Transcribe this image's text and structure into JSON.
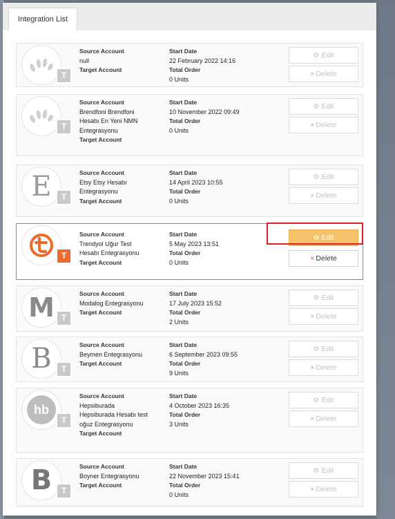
{
  "tab": {
    "label": "Integration List"
  },
  "labels": {
    "source": "Source Account",
    "target": "Target Account",
    "start": "Start Date",
    "total": "Total Order",
    "edit": "Edit",
    "delete": "Delete"
  },
  "cards": [
    {
      "source_lines": [
        "null"
      ],
      "start_date": "22 February 2022 14:16",
      "total": "0 Units",
      "logo": "paw-icon",
      "badge": "T"
    },
    {
      "source_lines": [
        "Brendfoni Brendfoni",
        "Hesabı En Yeni NMN",
        "Entegrasyonu"
      ],
      "start_date": "10 November 2022 09:49",
      "total": "0 Units",
      "logo": "paw-icon",
      "badge": "T"
    },
    {
      "source_lines": [
        "Etsy Etsy Hesabı",
        "Entegrasyonu"
      ],
      "start_date": "14 April 2023 10:55",
      "total": "0 Units",
      "logo": "E",
      "badge": "T"
    },
    {
      "source_lines": [
        "Trendyol Uğur Test",
        "Hesabı Entegrasyonu"
      ],
      "start_date": "5 May 2023 13:51",
      "total": "0 Units",
      "logo": "trendyol-icon",
      "badge": "T",
      "active": true
    },
    {
      "source_lines": [
        "Modalog Entegrasyonu"
      ],
      "start_date": "17 July 2023 15:52",
      "total": "2 Units",
      "logo": "M",
      "badge": "T"
    },
    {
      "source_lines": [
        "Beymen Entegrasyonu"
      ],
      "start_date": "6 September 2023 09:55",
      "total": "9 Units",
      "logo": "B",
      "badge": "T"
    },
    {
      "source_lines": [
        "Hepsiburada",
        "Hepsiburada Hesabı test",
        "oğuz Entegrasyonu"
      ],
      "start_date": "4 October 2023 16:35",
      "total": "3 Units",
      "logo": "hb",
      "badge": "T"
    },
    {
      "source_lines": [
        "Boyner Entegrasyonu"
      ],
      "start_date": "22 November 2023 15:41",
      "total": "0 Units",
      "logo": "B",
      "badge": "T"
    }
  ],
  "colors": {
    "accent": "#f5c26b",
    "highlight": "#e02020",
    "trendyol": "#ee6a2c"
  }
}
